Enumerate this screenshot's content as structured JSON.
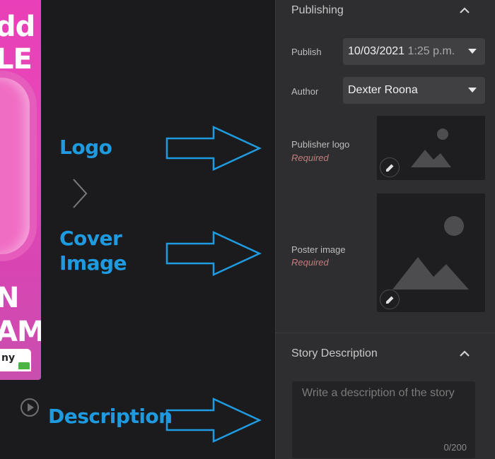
{
  "preview": {
    "lines": [
      "dd",
      "LE",
      "N",
      "AM"
    ],
    "badge_text": "ny"
  },
  "annotations": {
    "logo": "Logo",
    "cover_line1": "Cover",
    "cover_line2": "Image",
    "description": "Description"
  },
  "publishing": {
    "title": "Publishing",
    "publish_label": "Publish",
    "publish_date": "10/03/2021",
    "publish_time": "1:25 p.m.",
    "author_label": "Author",
    "author_value": "Dexter Roona",
    "logo_label": "Publisher logo",
    "logo_required": "Required",
    "poster_label": "Poster image",
    "poster_required": "Required"
  },
  "story_description": {
    "title": "Story Description",
    "placeholder": "Write a description of the story",
    "counter": "0/200"
  },
  "colors": {
    "accent": "#1e9be0",
    "panel_bg": "#2e2e30",
    "required": "#c47c7c",
    "preview_pink": "#e93fb8"
  }
}
